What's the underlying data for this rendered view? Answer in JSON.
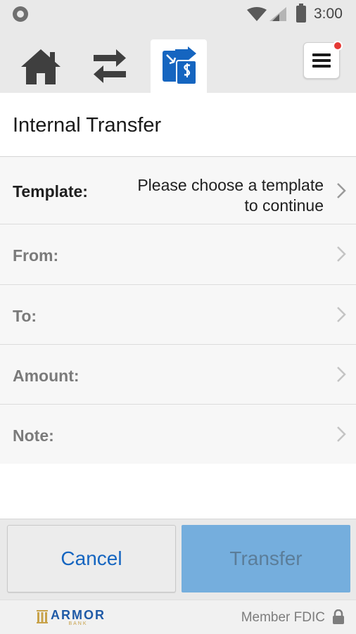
{
  "status_bar": {
    "time": "3:00"
  },
  "nav": {
    "tabs": [
      {
        "icon": "home-icon"
      },
      {
        "icon": "transfer-arrows-icon"
      },
      {
        "icon": "money-transfer-icon",
        "active": true
      }
    ],
    "menu_icon": "hamburger-menu-icon",
    "has_notification": true
  },
  "page": {
    "title": "Internal Transfer"
  },
  "form": {
    "template": {
      "label": "Template:",
      "value_line1": "Please choose a template",
      "value_line2": "to continue"
    },
    "from": {
      "label": "From:"
    },
    "to": {
      "label": "To:"
    },
    "amount": {
      "label": "Amount:"
    },
    "note": {
      "label": "Note:"
    }
  },
  "actions": {
    "cancel_label": "Cancel",
    "transfer_label": "Transfer"
  },
  "footer": {
    "bank_name": "ARMOR",
    "bank_sub": "BANK",
    "member_text": "Member FDIC"
  },
  "colors": {
    "accent": "#1565c0",
    "transfer_disabled": "#75aedd",
    "notification": "#e53935"
  }
}
